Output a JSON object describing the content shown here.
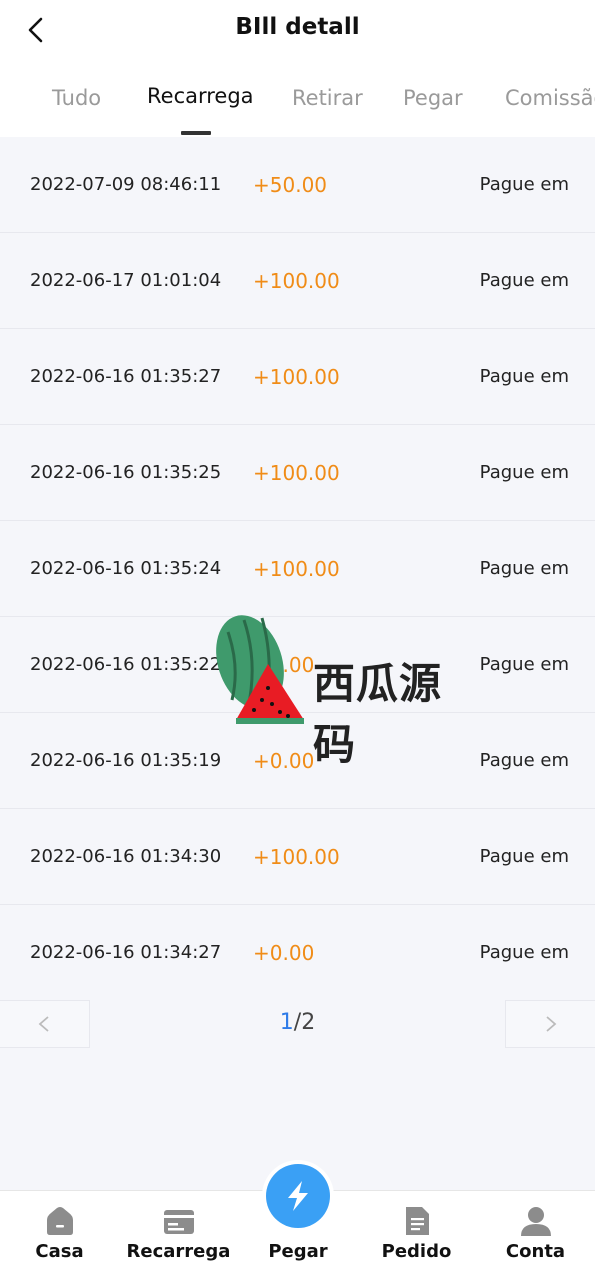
{
  "header": {
    "title": "BIll detall"
  },
  "tabs": [
    {
      "label": "Tudo"
    },
    {
      "label": "Recarrega"
    },
    {
      "label": "Retirar"
    },
    {
      "label": "Pegar"
    },
    {
      "label": "Comissão"
    }
  ],
  "records": [
    {
      "time": "2022-07-09 08:46:11",
      "amount": "+50.00",
      "status": "Pague em"
    },
    {
      "time": "2022-06-17 01:01:04",
      "amount": "+100.00",
      "status": "Pague em"
    },
    {
      "time": "2022-06-16 01:35:27",
      "amount": "+100.00",
      "status": "Pague em"
    },
    {
      "time": "2022-06-16 01:35:25",
      "amount": "+100.00",
      "status": "Pague em"
    },
    {
      "time": "2022-06-16 01:35:24",
      "amount": "+100.00",
      "status": "Pague em"
    },
    {
      "time": "2022-06-16 01:35:22",
      "amount": "+0.00",
      "status": "Pague em"
    },
    {
      "time": "2022-06-16 01:35:19",
      "amount": "+0.00",
      "status": "Pague em"
    },
    {
      "time": "2022-06-16 01:34:30",
      "amount": "+100.00",
      "status": "Pague em"
    },
    {
      "time": "2022-06-16 01:34:27",
      "amount": "+0.00",
      "status": "Pague em"
    }
  ],
  "pagination": {
    "current": "1",
    "separator": "/",
    "total": "2"
  },
  "watermark": {
    "text": "西瓜源码"
  },
  "bottom_nav": {
    "home": "Casa",
    "recharge": "Recarrega",
    "grab": "Pegar",
    "order": "Pedido",
    "account": "Conta"
  },
  "colors": {
    "amount": "#f08c17",
    "accent_blue": "#3aa0f5",
    "page_current": "#2e7be8",
    "nav_icon": "#8c8c8c"
  }
}
